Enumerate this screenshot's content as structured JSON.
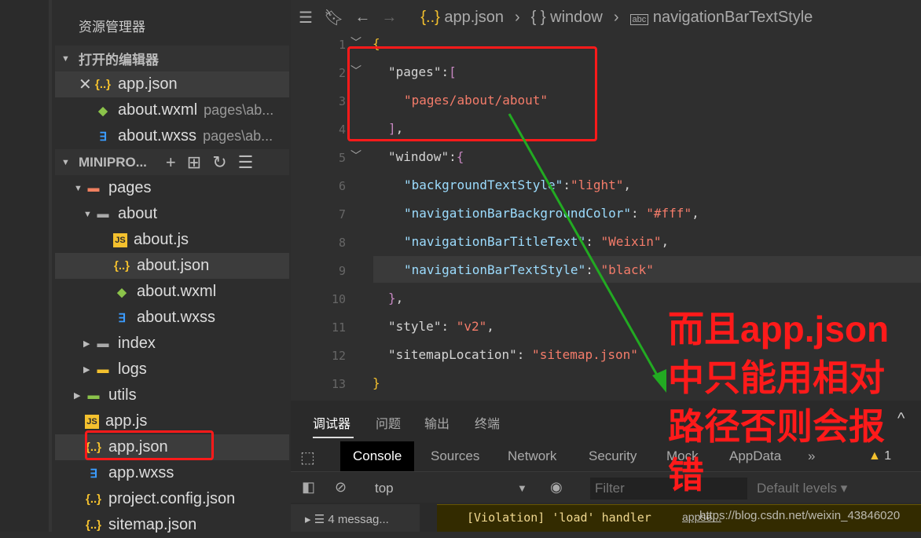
{
  "sidebar": {
    "title": "资源管理器",
    "open_editors": "打开的编辑器",
    "open_files": [
      {
        "name": "app.json",
        "icon": "json"
      },
      {
        "name": "about.wxml",
        "path": "pages\\ab...",
        "icon": "wxml"
      },
      {
        "name": "about.wxss",
        "path": "pages\\ab...",
        "icon": "wxss"
      }
    ],
    "project": "MINIPRO...",
    "tree": [
      {
        "name": "pages",
        "icon": "folder-pages",
        "level": 1,
        "expanded": true
      },
      {
        "name": "about",
        "icon": "folder",
        "level": 2,
        "expanded": true
      },
      {
        "name": "about.js",
        "icon": "js",
        "level": 3
      },
      {
        "name": "about.json",
        "icon": "json",
        "level": 3,
        "selected": true
      },
      {
        "name": "about.wxml",
        "icon": "wxml",
        "level": 3
      },
      {
        "name": "about.wxss",
        "icon": "wxss",
        "level": 3
      },
      {
        "name": "index",
        "icon": "folder",
        "level": 2,
        "expanded": false
      },
      {
        "name": "logs",
        "icon": "folder-logs",
        "level": 2,
        "expanded": false
      },
      {
        "name": "utils",
        "icon": "folder-utils",
        "level": 1,
        "expanded": false
      },
      {
        "name": "app.js",
        "icon": "js",
        "level": 1
      },
      {
        "name": "app.json",
        "icon": "json",
        "level": 1,
        "selected": true
      },
      {
        "name": "app.wxss",
        "icon": "wxss",
        "level": 1
      },
      {
        "name": "project.config.json",
        "icon": "json",
        "level": 1
      },
      {
        "name": "sitemap.json",
        "icon": "json",
        "level": 1
      }
    ]
  },
  "breadcrumb": [
    "app.json",
    "window",
    "navigationBarTextStyle"
  ],
  "code": {
    "pages_key": "pages",
    "pages_value": "pages/about/about",
    "window_key": "window",
    "window": [
      [
        "backgroundTextStyle",
        "light"
      ],
      [
        "navigationBarBackgroundColor",
        "#fff"
      ],
      [
        "navigationBarTitleText",
        "Weixin"
      ],
      [
        "navigationBarTextStyle",
        "black"
      ]
    ],
    "style_key": "style",
    "style_value": "v2",
    "sitemap_key": "sitemapLocation",
    "sitemap_value": "sitemap.json",
    "line_numbers": [
      "1",
      "2",
      "3",
      "4",
      "5",
      "6",
      "7",
      "8",
      "9",
      "10",
      "11",
      "12",
      "13"
    ]
  },
  "panel": {
    "tabs": [
      "调试器",
      "问题",
      "输出",
      "终端"
    ],
    "devtools_tabs": [
      "Console",
      "Sources",
      "Network",
      "Security",
      "Mock",
      "AppData"
    ],
    "more": "»",
    "warning_count": "1",
    "context": "top",
    "filter_placeholder": "Filter",
    "levels": "Default levels ▾",
    "messages": "4 messag...",
    "log": "[Violation] 'load' handler",
    "log_link": "appse...",
    "watermark": "https://blog.csdn.net/weixin_43846020"
  },
  "annotation": "而且app.json中只能用相对路径否则会报错",
  "colors": {
    "annotation": "#ff1a1a",
    "arrow": "#22aa22"
  }
}
